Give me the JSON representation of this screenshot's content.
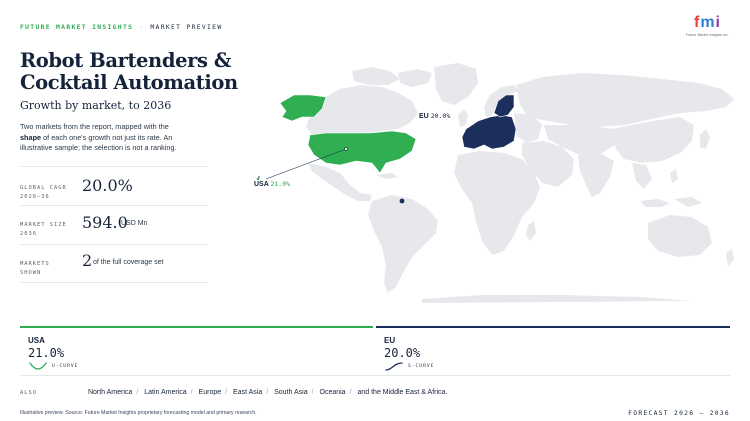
{
  "header": {
    "brand": "FUTURE MARKET INSIGHTS",
    "separator": "·",
    "section": "MARKET PREVIEW",
    "logo_letters": [
      "f",
      "m",
      "i"
    ],
    "logo_sub": "Future Market Insights Inc."
  },
  "title": "Robot Bartenders & Cocktail Automation",
  "subtitle": "Growth by market, to 2036",
  "description": {
    "part1": "Two markets from the report, mapped with the ",
    "bold": "shape",
    "part2": " of each one's growth not just its rate. An illustrative sample; the selection is not a ranking."
  },
  "stats": [
    {
      "label1": "GLOBAL CAGR",
      "label2": "2026–36",
      "value": "20.0%",
      "unit": ""
    },
    {
      "label1": "MARKET SIZE",
      "label2": "2036",
      "value": "594.0",
      "unit": "USD Mn"
    },
    {
      "label1": "MARKETS",
      "label2": "SHOWN",
      "value": "2",
      "unit": "of the full coverage set"
    }
  ],
  "map": {
    "highlights": [
      {
        "region": "USA",
        "value": "21.0%",
        "color": "#2fae52"
      },
      {
        "region": "EU",
        "value": "20.0%",
        "color": "#1c2f5c"
      }
    ],
    "land_color": "#e6e8eb"
  },
  "markets": [
    {
      "name": "USA",
      "cagr": "21.0%",
      "curve": "U-CURVE",
      "color": "#2fae52"
    },
    {
      "name": "EU",
      "cagr": "20.0%",
      "curve": "S-CURVE",
      "color": "#1c2f5c"
    }
  ],
  "also": {
    "label": "ALSO",
    "regions": [
      "North America",
      "Latin America",
      "Europe",
      "East Asia",
      "South Asia",
      "Oceania",
      "and the Middle East & Africa."
    ]
  },
  "footer": {
    "note": "Illustrative preview. Source: Future Market Insights proprietary forecasting model and primary research.",
    "forecast": "FORECAST 2026 – 2036"
  }
}
